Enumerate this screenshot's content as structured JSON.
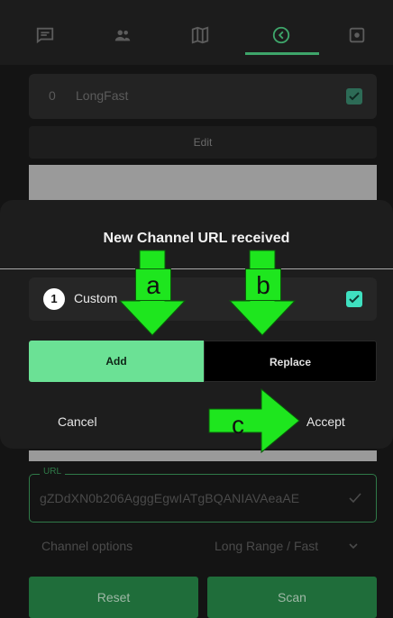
{
  "tabs": [
    {
      "name": "messages"
    },
    {
      "name": "nodes"
    },
    {
      "name": "map"
    },
    {
      "name": "channel"
    },
    {
      "name": "settings"
    }
  ],
  "primary_channel": {
    "index": "0",
    "name": "LongFast"
  },
  "edit_label": "Edit",
  "url_field": {
    "label": "URL",
    "value": "gZDdXN0b206AgggEgwIATgBQANIAVAeaAE"
  },
  "channel_options": {
    "label": "Channel options",
    "value": "Long Range / Fast"
  },
  "reset_label": "Reset",
  "scan_label": "Scan",
  "dialog": {
    "title": "New Channel URL received",
    "channel": {
      "index": "1",
      "name": "Custom"
    },
    "add_label": "Add",
    "replace_label": "Replace",
    "cancel_label": "Cancel",
    "accept_label": "Accept"
  },
  "annotations": {
    "a": "a",
    "b": "b",
    "c": "c"
  },
  "colors": {
    "accent_green": "#6be195",
    "arrow_green": "#1ee61e",
    "dark_green": "#1f6d3a",
    "teal_check": "#3fe0c0"
  }
}
